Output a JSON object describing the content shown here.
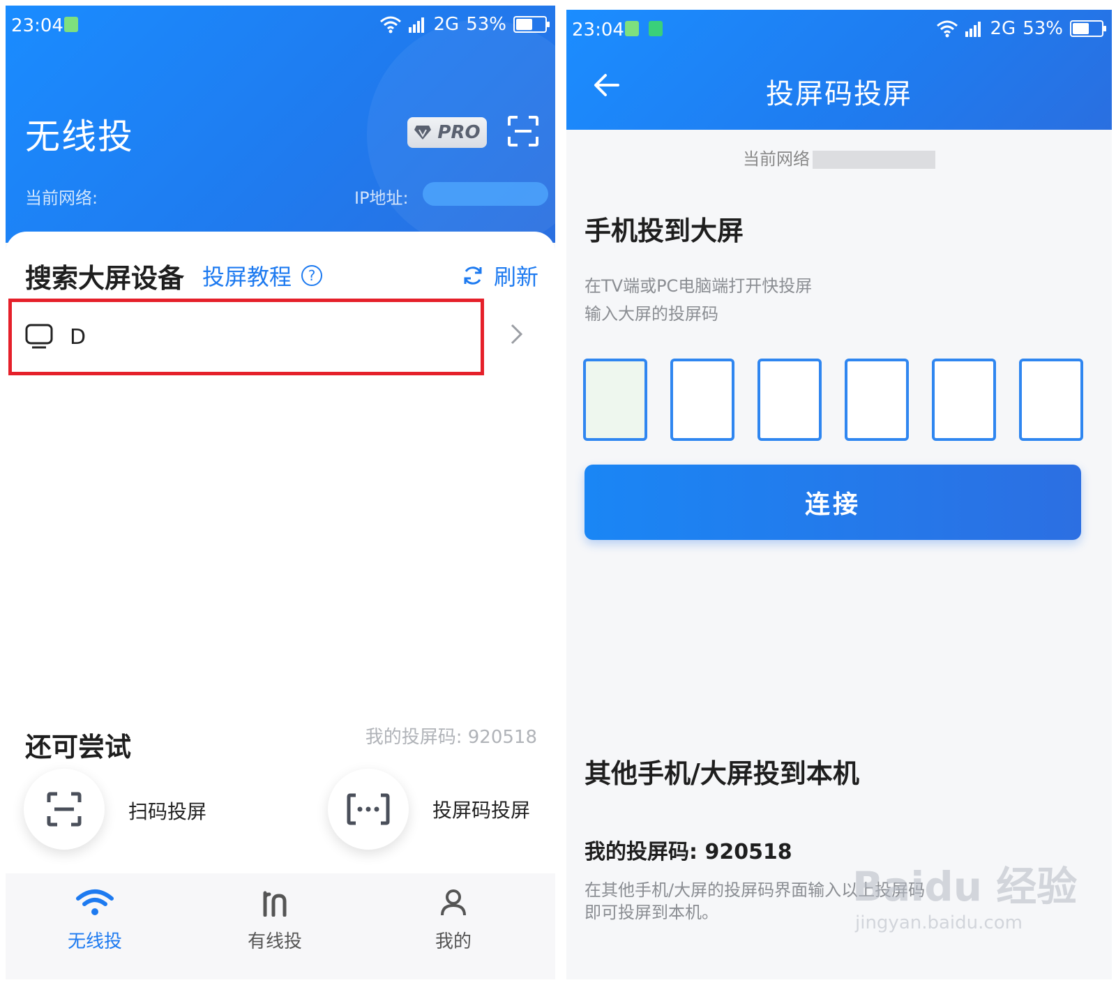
{
  "left": {
    "status": {
      "time": "23:04",
      "network": "2G",
      "battery": "53%",
      "battery_level": 0.53
    },
    "app_title": "无线投",
    "pro_badge": "PRO",
    "network_label": "当前网络: ",
    "ip_label": "IP地址: ",
    "search_title": "搜索大屏设备",
    "tutorial_link": "投屏教程",
    "refresh_label": "刷新",
    "device_name": "D",
    "try_title": "还可尝试",
    "my_code": "我的投屏码: 920518",
    "options": [
      {
        "label": "扫码投屏",
        "icon": "scan-icon"
      },
      {
        "label": "投屏码投屏",
        "icon": "code-icon"
      }
    ],
    "tabs": [
      {
        "label": "无线投",
        "icon": "wifi-icon",
        "active": true
      },
      {
        "label": "有线投",
        "icon": "cable-icon",
        "active": false
      },
      {
        "label": "我的",
        "icon": "user-icon",
        "active": false
      }
    ]
  },
  "right": {
    "status": {
      "time": "23:04",
      "network": "2G",
      "battery": "53%",
      "battery_level": 0.53
    },
    "title": "投屏码投屏",
    "network_label": "当前网络",
    "section1_title": "手机投到大屏",
    "hint_line1": "在TV端或PC电脑端打开快投屏",
    "hint_line2": "输入大屏的投屏码",
    "code_boxes": [
      "",
      "",
      "",
      "",
      "",
      ""
    ],
    "connect_button": "连接",
    "section2_title": "其他手机/大屏投到本机",
    "my_code": "我的投屏码: 920518",
    "desc_line1": "在其他手机/大屏的投屏码界面输入以上投屏码",
    "desc_line2": "即可投屏到本机。",
    "watermark_main": "Baidu 经验",
    "watermark_url": "jingyan.baidu.com"
  },
  "colors": {
    "primary": "#1d7af0",
    "highlight_border": "#e5202a"
  }
}
